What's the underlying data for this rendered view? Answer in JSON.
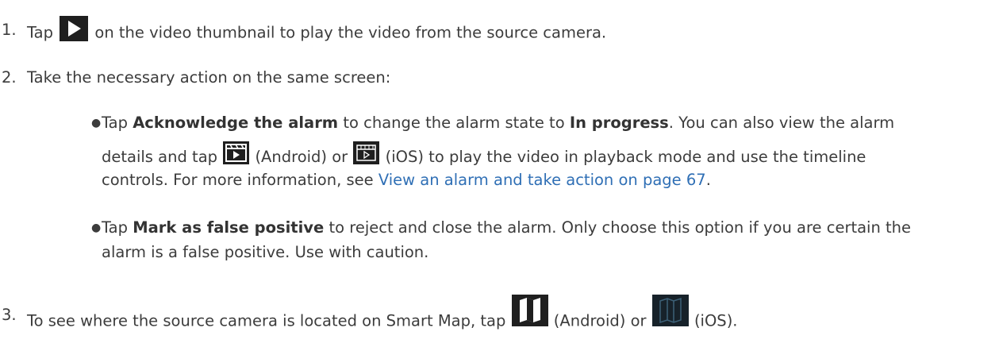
{
  "steps": [
    {
      "number": "1.",
      "before_icon": "Tap",
      "icon": "play-icon",
      "after_icon": "on the video thumbnail to play the video from the source camera."
    },
    {
      "number": "2.",
      "text": "Take the necessary action on the same screen:",
      "bullets": [
        {
          "pre": "Tap",
          "bold1": "Acknowledge the alarm",
          "mid": "to change the alarm state to",
          "bold2": "In progress",
          "post": ". You can also view the alarm",
          "line2_pre": "details and tap",
          "icon_android": "playback-android-icon",
          "android_label": "(Android) or",
          "icon_ios": "playback-ios-icon",
          "ios_label": "(iOS) to play the video in playback mode and use the timeline",
          "line3_pre": "controls. For more information, see",
          "link": "View an alarm and take action on page 67",
          "line3_post": "."
        },
        {
          "pre": "Tap",
          "bold1": "Mark as false positive",
          "mid": "to reject and close the alarm. Only choose this option if you are certain the",
          "line2": "alarm is a false positive. Use with caution."
        }
      ]
    },
    {
      "number": "3.",
      "before_icon": "To see where the source camera is located on Smart Map, tap",
      "icon_android": "map-android-icon",
      "android_label": "(Android) or",
      "icon_ios": "map-ios-icon",
      "ios_label": "(iOS)."
    }
  ],
  "colors": {
    "text": "#3c3c3c",
    "link": "#2f6fb5",
    "icon_dark": "#1f1f1f"
  }
}
